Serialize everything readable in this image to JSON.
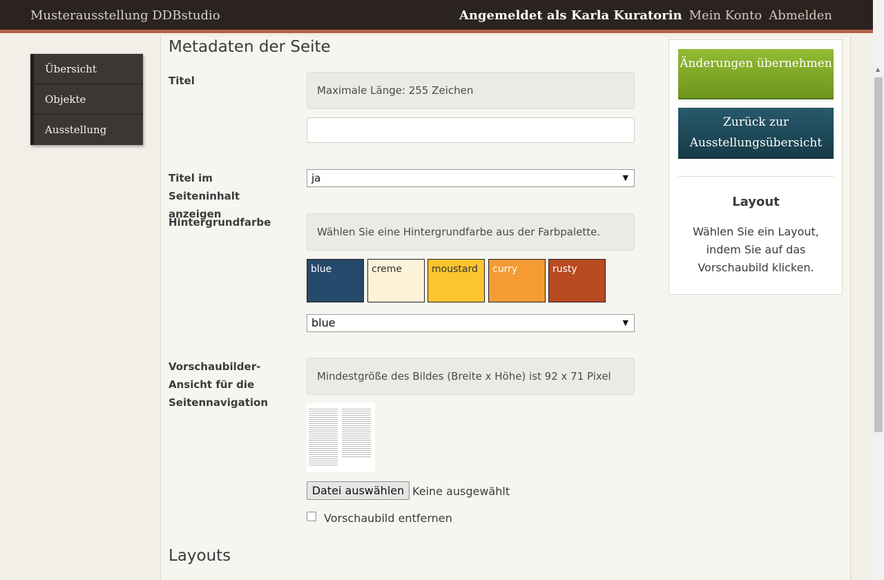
{
  "topbar": {
    "brand": "Musterausstellung DDBstudio",
    "logged_in_as": "Angemeldet als Karla Kuratorin",
    "my_account": "Mein Konto",
    "logout": "Abmelden"
  },
  "sidebar": {
    "items": [
      {
        "label": "Übersicht"
      },
      {
        "label": "Objekte"
      },
      {
        "label": "Ausstellung"
      }
    ]
  },
  "main": {
    "section_title": "Metadaten der Seite",
    "title_field": {
      "label": "Titel",
      "hint": "Maximale Länge: 255 Zeichen",
      "value": ""
    },
    "show_title": {
      "label": "Titel im Seiteninhalt anzeigen",
      "selected": "ja"
    },
    "background": {
      "label": "Hintergrundfarbe",
      "hint": "Wählen Sie eine Hintergrundfarbe aus der Farbpalette.",
      "swatches": [
        {
          "name": "blue",
          "color": "#254a6b",
          "text_color": "#ffffff"
        },
        {
          "name": "creme",
          "color": "#fcf2d8",
          "text_color": "#333333"
        },
        {
          "name": "moustard",
          "color": "#fcc42f",
          "text_color": "#333333"
        },
        {
          "name": "curry",
          "color": "#f49b33",
          "text_color": "#ffffff"
        },
        {
          "name": "rusty",
          "color": "#b84a20",
          "text_color": "#ffffff"
        }
      ],
      "selected": "blue"
    },
    "thumbnail": {
      "label": "Vorschaubilder-Ansicht für die Seitennavigation",
      "hint": "Mindestgröße des Bildes (Breite x Höhe) ist 92 x 71 Pixel",
      "file_button": "Datei auswählen",
      "file_status": "Keine ausgewählt",
      "remove_label": "Vorschaubild entfernen"
    },
    "layouts_title": "Layouts"
  },
  "right_panel": {
    "apply_button": "Änderungen übernehmen",
    "back_button": "Zurück zur Ausstellungsübersicht",
    "layout_title": "Layout",
    "layout_text": "Wählen Sie ein Layout, indem Sie auf das Vorschaubild klicken."
  }
}
